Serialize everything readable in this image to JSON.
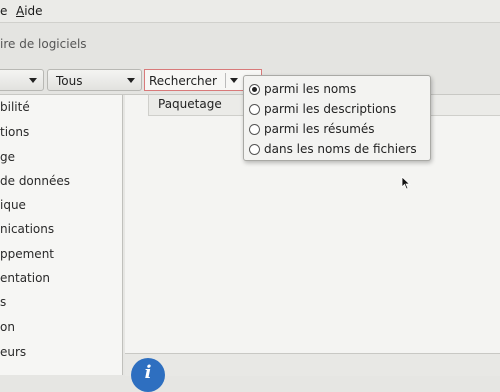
{
  "menubar": {
    "item1_suffix": "e",
    "aide_acc": "A",
    "aide_rest": "ide"
  },
  "window": {
    "title_fragment": "ire de logiciels"
  },
  "toolbar": {
    "filter1_value": "",
    "filter2_value": "Tous",
    "search_value": "Rechercher"
  },
  "sidebar": {
    "categories": [
      "bilité",
      "tions",
      "ge",
      "de données",
      "ique",
      "nications",
      "ppement",
      "entation",
      "s",
      "on",
      "eurs"
    ]
  },
  "content": {
    "column_header": "Paquetage"
  },
  "search_popup": {
    "options": [
      {
        "label": "parmi les noms",
        "checked": true
      },
      {
        "label": "parmi les descriptions",
        "checked": false
      },
      {
        "label": "parmi les résumés",
        "checked": false
      },
      {
        "label": "dans les noms de fichiers",
        "checked": false
      }
    ]
  },
  "status": {
    "info_glyph": "i"
  }
}
